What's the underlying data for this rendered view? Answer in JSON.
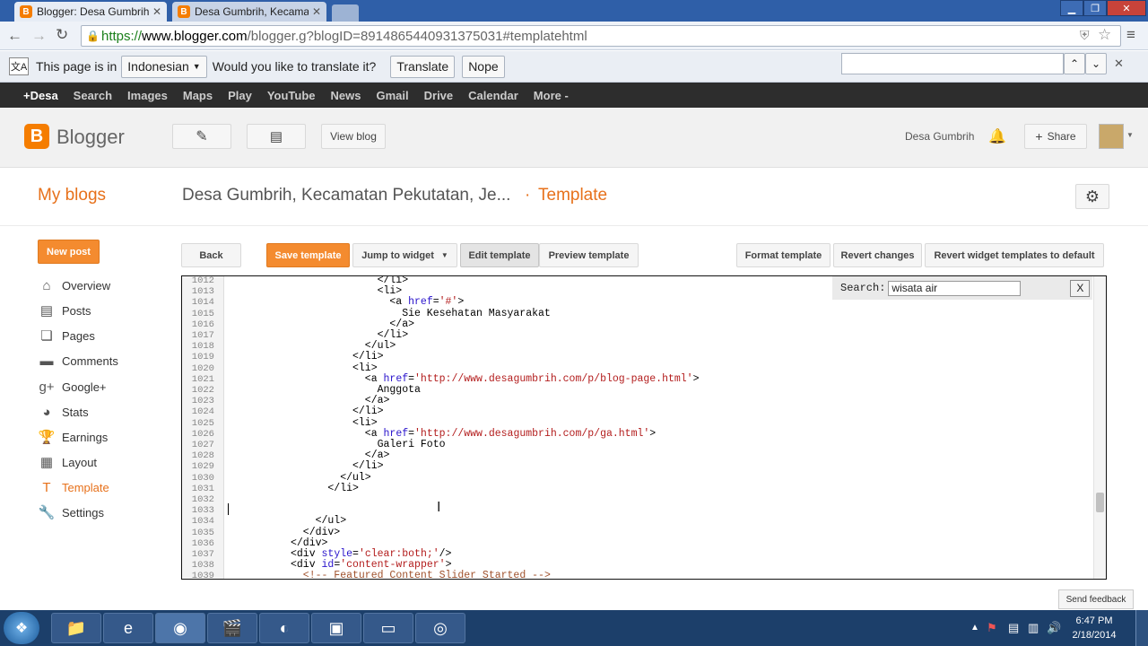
{
  "browser": {
    "tabs": [
      {
        "label": "Blogger: Desa Gumbrih, K",
        "active": true
      },
      {
        "label": "Desa Gumbrih, Kecamatan",
        "active": false
      }
    ],
    "url_scheme": "https://",
    "url_host": "www.blogger.com",
    "url_path": "/blogger.g?blogID=8914865440931375031#templatehtml",
    "translate": {
      "text_prefix": "This page is in",
      "language": "Indonesian",
      "question": "Would you like to translate it?",
      "translate_label": "Translate",
      "nope_label": "Nope"
    }
  },
  "gbar": {
    "items": [
      "+Desa",
      "Search",
      "Images",
      "Maps",
      "Play",
      "YouTube",
      "News",
      "Gmail",
      "Drive",
      "Calendar",
      "More -"
    ]
  },
  "header": {
    "logo_text": "Blogger",
    "view_blog_label": "View blog",
    "user_name": "Desa Gumbrih",
    "share_label": "Share"
  },
  "titlebar": {
    "my_blogs": "My blogs",
    "blog_name": "Desa Gumbrih, Kecamatan Pekutatan, Je...",
    "separator": "·",
    "section": "Template"
  },
  "sidebar": {
    "new_post_label": "New post",
    "items": [
      {
        "label": "Overview",
        "icon": "home-icon"
      },
      {
        "label": "Posts",
        "icon": "posts-icon"
      },
      {
        "label": "Pages",
        "icon": "pages-icon"
      },
      {
        "label": "Comments",
        "icon": "comments-icon"
      },
      {
        "label": "Google+",
        "icon": "google-plus-icon"
      },
      {
        "label": "Stats",
        "icon": "stats-icon"
      },
      {
        "label": "Earnings",
        "icon": "earnings-icon"
      },
      {
        "label": "Layout",
        "icon": "layout-icon"
      },
      {
        "label": "Template",
        "icon": "template-icon"
      },
      {
        "label": "Settings",
        "icon": "settings-icon"
      }
    ]
  },
  "toolbar": {
    "back": "Back",
    "save": "Save template",
    "jump": "Jump to widget",
    "edit": "Edit template",
    "preview": "Preview template",
    "format": "Format template",
    "revert": "Revert changes",
    "revert_widgets": "Revert widget templates to default"
  },
  "editor": {
    "search_label": "Search:",
    "search_value": "wisata air",
    "search_close": "X",
    "lines": [
      {
        "n": "1012",
        "indent": 24,
        "parts": [
          [
            "t",
            "</li>"
          ]
        ]
      },
      {
        "n": "1013",
        "indent": 24,
        "parts": [
          [
            "t",
            "<li>"
          ]
        ]
      },
      {
        "n": "1014",
        "indent": 26,
        "parts": [
          [
            "t",
            "<a "
          ],
          [
            "k",
            "href"
          ],
          [
            "t",
            "="
          ],
          [
            "s",
            "'#'"
          ],
          [
            "t",
            ">"
          ]
        ]
      },
      {
        "n": "1015",
        "indent": 28,
        "parts": [
          [
            "t",
            "Sie Kesehatan Masyarakat"
          ]
        ]
      },
      {
        "n": "1016",
        "indent": 26,
        "parts": [
          [
            "t",
            "</a>"
          ]
        ]
      },
      {
        "n": "1017",
        "indent": 24,
        "parts": [
          [
            "t",
            "</li>"
          ]
        ]
      },
      {
        "n": "1018",
        "indent": 22,
        "parts": [
          [
            "t",
            "</ul>"
          ]
        ]
      },
      {
        "n": "1019",
        "indent": 20,
        "parts": [
          [
            "t",
            "</li>"
          ]
        ]
      },
      {
        "n": "1020",
        "indent": 20,
        "parts": [
          [
            "t",
            "<li>"
          ]
        ]
      },
      {
        "n": "1021",
        "indent": 22,
        "parts": [
          [
            "t",
            "<a "
          ],
          [
            "k",
            "href"
          ],
          [
            "t",
            "="
          ],
          [
            "s",
            "'http://www.desagumbrih.com/p/blog-page.html'"
          ],
          [
            "t",
            ">"
          ]
        ]
      },
      {
        "n": "1022",
        "indent": 24,
        "parts": [
          [
            "t",
            "Anggota"
          ]
        ]
      },
      {
        "n": "1023",
        "indent": 22,
        "parts": [
          [
            "t",
            "</a>"
          ]
        ]
      },
      {
        "n": "1024",
        "indent": 20,
        "parts": [
          [
            "t",
            "</li>"
          ]
        ]
      },
      {
        "n": "1025",
        "indent": 20,
        "parts": [
          [
            "t",
            "<li>"
          ]
        ]
      },
      {
        "n": "1026",
        "indent": 22,
        "parts": [
          [
            "t",
            "<a "
          ],
          [
            "k",
            "href"
          ],
          [
            "t",
            "="
          ],
          [
            "s",
            "'http://www.desagumbrih.com/p/ga.html'"
          ],
          [
            "t",
            ">"
          ]
        ]
      },
      {
        "n": "1027",
        "indent": 24,
        "parts": [
          [
            "t",
            "Galeri Foto"
          ]
        ]
      },
      {
        "n": "1028",
        "indent": 22,
        "parts": [
          [
            "t",
            "</a>"
          ]
        ]
      },
      {
        "n": "1029",
        "indent": 20,
        "parts": [
          [
            "t",
            "</li>"
          ]
        ]
      },
      {
        "n": "1030",
        "indent": 18,
        "parts": [
          [
            "t",
            "</ul>"
          ]
        ]
      },
      {
        "n": "1031",
        "indent": 16,
        "parts": [
          [
            "t",
            "</li>"
          ]
        ]
      },
      {
        "n": "1032",
        "indent": 0,
        "parts": []
      },
      {
        "n": "1033",
        "indent": 0,
        "parts": []
      },
      {
        "n": "1034",
        "indent": 14,
        "parts": [
          [
            "t",
            "</ul>"
          ]
        ]
      },
      {
        "n": "1035",
        "indent": 12,
        "parts": [
          [
            "t",
            "</div>"
          ]
        ]
      },
      {
        "n": "1036",
        "indent": 10,
        "parts": [
          [
            "t",
            "</div>"
          ]
        ]
      },
      {
        "n": "1037",
        "indent": 10,
        "parts": [
          [
            "t",
            "<div "
          ],
          [
            "k",
            "style"
          ],
          [
            "t",
            "="
          ],
          [
            "s",
            "'clear:both;'"
          ],
          [
            "t",
            "/>"
          ]
        ]
      },
      {
        "n": "1038",
        "indent": 10,
        "parts": [
          [
            "t",
            "<div "
          ],
          [
            "k",
            "id"
          ],
          [
            "t",
            "="
          ],
          [
            "s",
            "'content-wrapper'"
          ],
          [
            "t",
            ">"
          ]
        ]
      },
      {
        "n": "1039",
        "indent": 12,
        "parts": [
          [
            "c",
            "<!-- Featured Content Slider Started -->"
          ]
        ]
      }
    ]
  },
  "feedback_label": "Send feedback",
  "taskbar": {
    "time": "6:47 PM",
    "date": "2/18/2014"
  }
}
